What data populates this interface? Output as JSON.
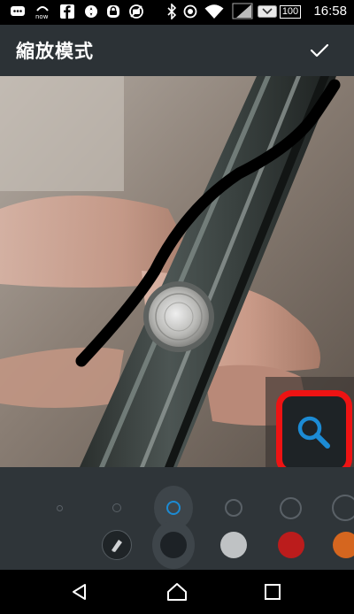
{
  "status_bar": {
    "time": "16:58",
    "battery": "100",
    "icons": [
      "message-icon",
      "now-app-icon",
      "facebook-icon",
      "gear-icon",
      "lock-icon",
      "no-camera-icon",
      "bluetooth-icon",
      "sync-icon",
      "wifi-icon",
      "signal-icon",
      "battery-icon"
    ]
  },
  "toolbar": {
    "title": "縮放模式",
    "confirm_icon": "check-icon"
  },
  "photo": {
    "description_icon": "photo-content",
    "zoom_icon": "magnifier-icon"
  },
  "tools": {
    "sizes": [
      "size-xs",
      "size-s",
      "size-m",
      "size-l",
      "size-xl",
      "size-xxl"
    ],
    "selected_size": 2,
    "colors": [
      "#1d2226",
      "#bfc2c4",
      "#bb1c1c",
      "#d5661f"
    ],
    "selected_color": 0,
    "eraser_icon": "eraser-icon"
  },
  "nav": {
    "back_icon": "back-icon",
    "home_icon": "home-icon",
    "recents_icon": "recents-icon"
  }
}
